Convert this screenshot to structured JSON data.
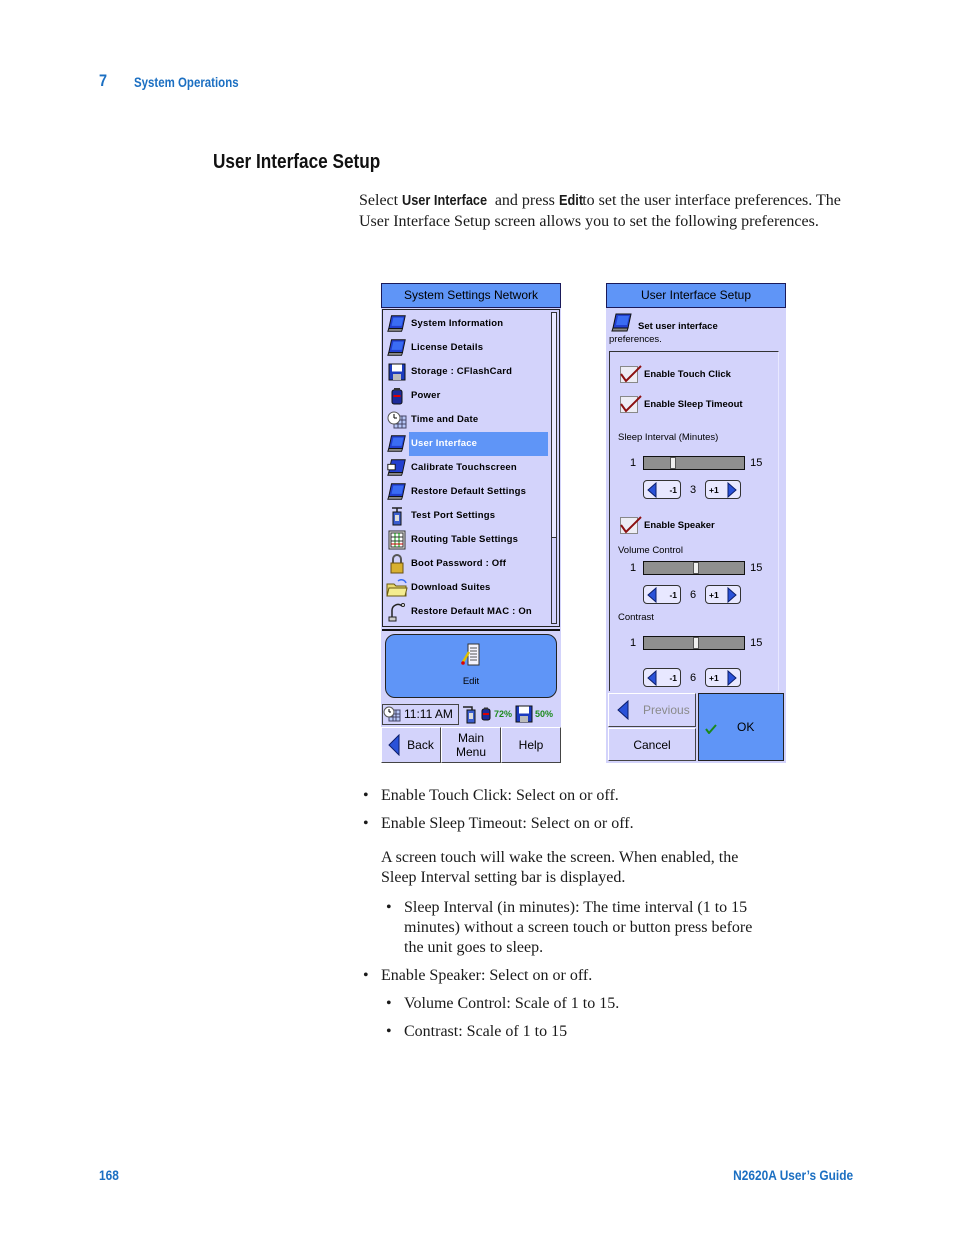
{
  "header": {
    "chapter_number": "7",
    "chapter_title": "System Operations"
  },
  "section": {
    "heading": "User Interface Setup",
    "intro": {
      "part1": "Select ",
      "bold1": "User Interface",
      "part2": " and press ",
      "bold2": "Edit",
      "part3": " to set the user interface preferences. The User Interface Setup screen allows you to set the following preferences."
    }
  },
  "left_screen": {
    "title": "System Settings Network",
    "menu_items": [
      {
        "label": "System Information",
        "icon": "pda-icon"
      },
      {
        "label": "License Details",
        "icon": "pda-icon"
      },
      {
        "label": "Storage : CFlashCard",
        "icon": "floppy-disk-icon"
      },
      {
        "label": "Power",
        "icon": "battery-icon"
      },
      {
        "label": "Time and Date",
        "icon": "clock-calendar-icon"
      },
      {
        "label": "User Interface",
        "icon": "pda-icon",
        "selected": true
      },
      {
        "label": "Calibrate Touchscreen",
        "icon": "touchscreen-icon"
      },
      {
        "label": "Restore Default Settings",
        "icon": "pda-icon"
      },
      {
        "label": "Test Port Settings",
        "icon": "test-port-icon"
      },
      {
        "label": "Routing Table Settings",
        "icon": "table-icon"
      },
      {
        "label": "Boot Password : Off",
        "icon": "padlock-icon"
      },
      {
        "label": "Download Suites",
        "icon": "folder-icon"
      },
      {
        "label": "Restore Default MAC : On",
        "icon": "cable-icon"
      }
    ],
    "edit_button": "Edit",
    "status": {
      "time": "11:11 AM",
      "battery_pct": "72%",
      "storage_pct": "50%"
    },
    "buttons": {
      "back": "Back",
      "main_menu_line1": "Main",
      "main_menu_line2": "Menu",
      "help": "Help"
    }
  },
  "right_screen": {
    "title": "User Interface Setup",
    "description_line1": "Set user interface",
    "description_line2": "preferences.",
    "enable_touch_click": {
      "label": "Enable Touch Click",
      "checked": true
    },
    "enable_sleep_timeout": {
      "label": "Enable Sleep Timeout",
      "checked": true
    },
    "sleep_interval": {
      "label": "Sleep Interval (Minutes)",
      "min": "1",
      "max": "15",
      "value": "3"
    },
    "enable_speaker": {
      "label": "Enable Speaker",
      "checked": true
    },
    "volume_control": {
      "label": "Volume Control",
      "min": "1",
      "max": "15",
      "value": "6"
    },
    "contrast": {
      "label": "Contrast",
      "min": "1",
      "max": "15",
      "value": "6"
    },
    "decrement_label": "-1",
    "increment_label": "+1",
    "buttons": {
      "previous": "Previous",
      "cancel": "Cancel",
      "ok": "OK"
    }
  },
  "bullets": [
    {
      "level": 1,
      "text": "Enable Touch Click: Select on or off."
    },
    {
      "level": 1,
      "text": "Enable Sleep Timeout: Select on or off."
    },
    {
      "level": 0,
      "text": "A screen touch will wake the screen. When enabled, the"
    },
    {
      "level": 0,
      "text": "Sleep Interval setting bar is displayed."
    },
    {
      "level": 2,
      "text": "Sleep Interval (in minutes): The time interval (1 to 15"
    },
    {
      "level": 0,
      "text": "minutes) without a screen touch or button press before"
    },
    {
      "level": 0,
      "text": "the unit goes to sleep."
    },
    {
      "level": 1,
      "text": "Enable Speaker: Select on or off."
    },
    {
      "level": 2,
      "text": "Volume Control: Scale of 1 to 15."
    },
    {
      "level": 2,
      "text": "Contrast: Scale of 1 to 15"
    }
  ],
  "footer": {
    "page_number": "168",
    "guide_title": "N2620A User’s Guide"
  }
}
